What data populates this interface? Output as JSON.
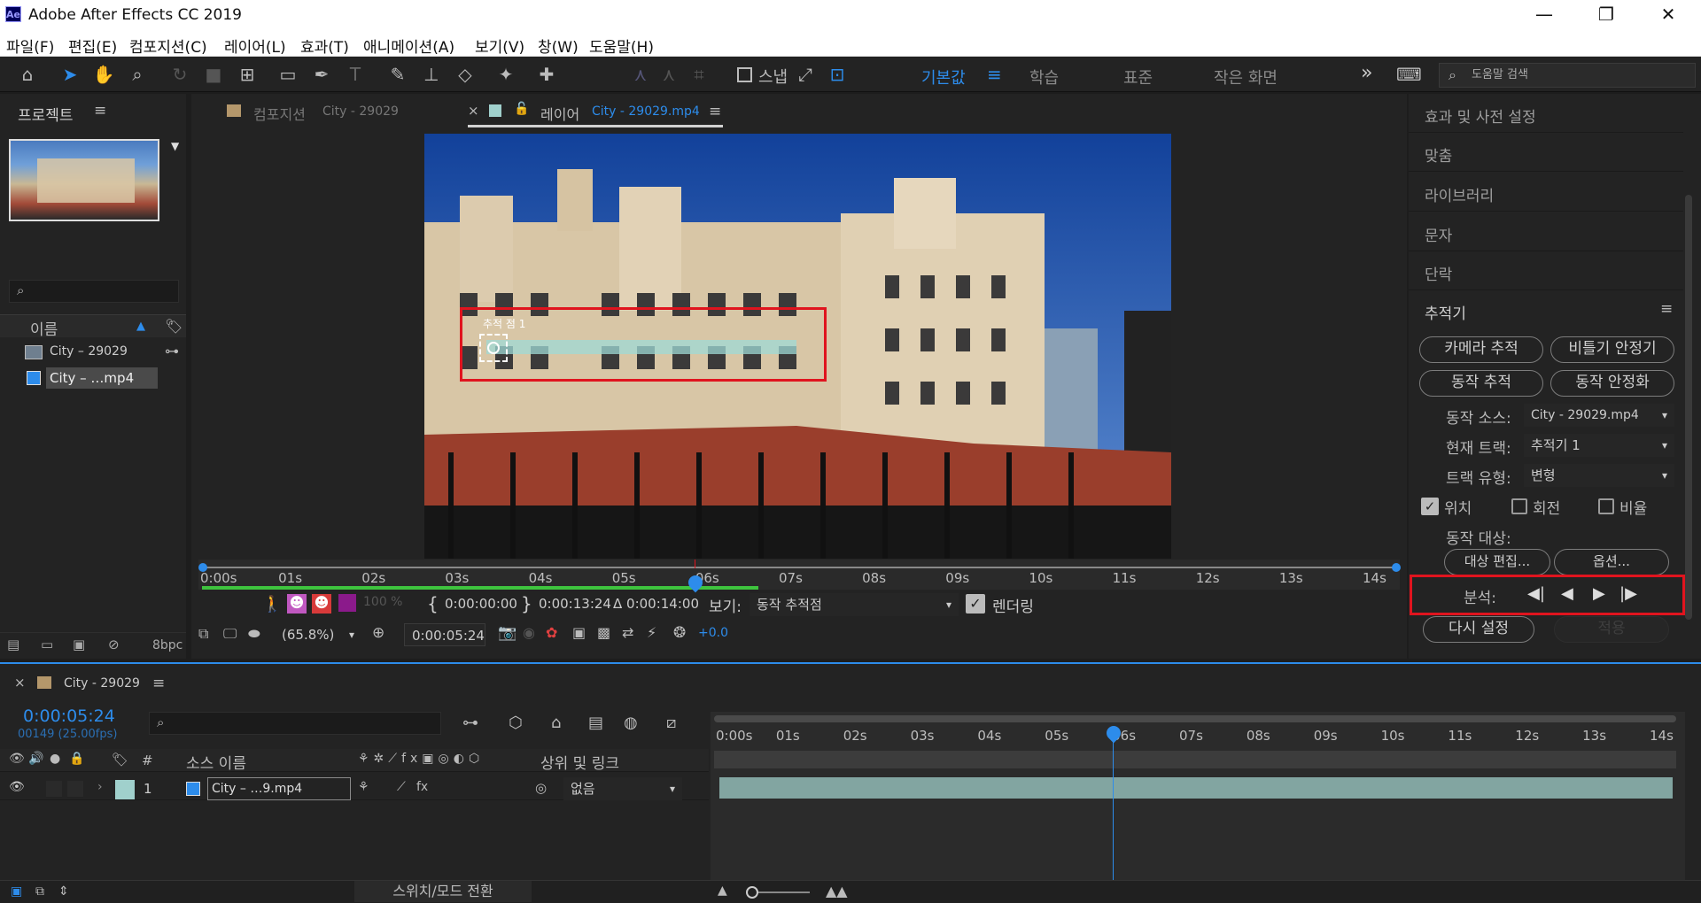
{
  "window": {
    "app_icon": "Ae",
    "title": "Adobe After Effects CC 2019",
    "minimize": "—",
    "maximize": "❐",
    "close": "✕"
  },
  "menu": [
    "파일(F)",
    "편집(E)",
    "컴포지션(C)",
    "레이어(L)",
    "효과(T)",
    "애니메이션(A)",
    "보기(V)",
    "창(W)",
    "도움말(H)"
  ],
  "toolbar": {
    "snap_label": "스냅",
    "workspaces": [
      "기본값",
      "학습",
      "표준",
      "작은 화면"
    ],
    "active_workspace": "기본값",
    "more": "»",
    "help_search_placeholder": "도움말 검색"
  },
  "project": {
    "title": "프로젝트",
    "search_placeholder": "",
    "name_header": "이름",
    "items": [
      {
        "name": "City – 29029",
        "icon": "composition-icon"
      },
      {
        "name": "City – …mp4",
        "icon": "footage-icon"
      }
    ],
    "bpc": "8bpc"
  },
  "viewer": {
    "tabs": [
      {
        "prefix": "컴포지션",
        "name": "City - 29029",
        "active": false
      },
      {
        "prefix": "레이어",
        "name": "City - 29029.mp4",
        "active": true
      }
    ],
    "track_point_label": "추적 점 1",
    "ruler_ticks": [
      "0:00s",
      "01s",
      "02s",
      "03s",
      "04s",
      "05s",
      "06s",
      "07s",
      "08s",
      "09s",
      "10s",
      "11s",
      "12s",
      "13s",
      "14s"
    ],
    "playhead_fraction": 0.42,
    "in_point": "0:00:00:00",
    "out_point": "0:00:13:24",
    "duration": "Δ 0:00:14:00",
    "view_label": "보기:",
    "view_value": "동작 추적점",
    "render_label": "렌더링",
    "zoom": "(65.8%)",
    "current_time": "0:00:05:24",
    "exposure": "+0.0",
    "opacity_value": "100 %"
  },
  "right_panel": {
    "collapsed_panels": [
      "효과 및 사전 설정",
      "맞춤",
      "라이브러리",
      "문자",
      "단락"
    ],
    "tracker": {
      "title": "추적기",
      "buttons": [
        "카메라 추적",
        "비틀기 안정기",
        "동작 추적",
        "동작 안정화"
      ],
      "motion_source_label": "동작 소스:",
      "motion_source_value": "City - 29029.mp4",
      "current_track_label": "현재 트랙:",
      "current_track_value": "추적기 1",
      "track_type_label": "트랙 유형:",
      "track_type_value": "변형",
      "position_label": "위치",
      "rotation_label": "회전",
      "scale_label": "비율",
      "position_checked": true,
      "rotation_checked": false,
      "scale_checked": false,
      "motion_target_label": "동작 대상:",
      "edit_target": "대상 편집...",
      "options": "옵션...",
      "analyze_label": "분석:",
      "reset": "다시 설정",
      "apply": "적용"
    }
  },
  "timeline": {
    "comp_name": "City - 29029",
    "timecode": "0:00:05:24",
    "frame_info": "00149 (25.00fps)",
    "search_placeholder": "",
    "col_num": "#",
    "col_source": "소스 이름",
    "col_parent": "상위 및 링크",
    "layer": {
      "index": "1",
      "name": "City – …9.mp4",
      "parent": "없음"
    },
    "ruler_ticks": [
      "0:00s",
      "01s",
      "02s",
      "03s",
      "04s",
      "05s",
      "06s",
      "07s",
      "08s",
      "09s",
      "10s",
      "11s",
      "12s",
      "13s",
      "14s"
    ],
    "playhead_fraction": 0.42,
    "toggle_label": "스위치/모드 전환"
  },
  "colors": {
    "accent": "#2d8ceb",
    "highlight_box": "#e0141e",
    "layer_bar": "#87aca8",
    "label_swatch": "#a0d0cc"
  }
}
